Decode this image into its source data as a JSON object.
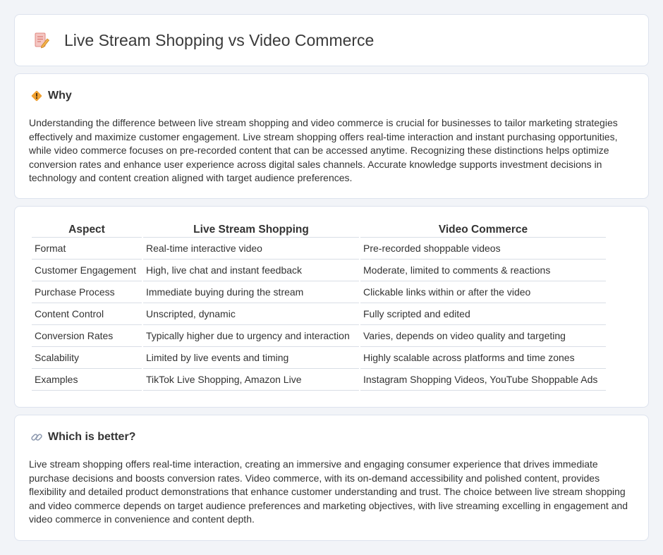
{
  "header": {
    "title": "Live Stream Shopping vs Video Commerce",
    "icon": "document-pen-icon"
  },
  "why": {
    "title": "Why",
    "icon": "diamond-signal-icon",
    "body": "Understanding the difference between live stream shopping and video commerce is crucial for businesses to tailor marketing strategies effectively and maximize customer engagement. Live stream shopping offers real-time interaction and instant purchasing opportunities, while video commerce focuses on pre-recorded content that can be accessed anytime. Recognizing these distinctions helps optimize conversion rates and enhance user experience across digital sales channels. Accurate knowledge supports investment decisions in technology and content creation aligned with target audience preferences."
  },
  "table": {
    "headers": [
      "Aspect",
      "Live Stream Shopping",
      "Video Commerce"
    ],
    "rows": [
      [
        "Format",
        "Real-time interactive video",
        "Pre-recorded shoppable videos"
      ],
      [
        "Customer Engagement",
        "High, live chat and instant feedback",
        "Moderate, limited to comments & reactions"
      ],
      [
        "Purchase Process",
        "Immediate buying during the stream",
        "Clickable links within or after the video"
      ],
      [
        "Content Control",
        "Unscripted, dynamic",
        "Fully scripted and edited"
      ],
      [
        "Conversion Rates",
        "Typically higher due to urgency and interaction",
        "Varies, depends on video quality and targeting"
      ],
      [
        "Scalability",
        "Limited by live events and timing",
        "Highly scalable across platforms and time zones"
      ],
      [
        "Examples",
        "TikTok Live Shopping, Amazon Live",
        "Instagram Shopping Videos, YouTube Shoppable Ads"
      ]
    ]
  },
  "better": {
    "title": "Which is better?",
    "icon": "link-icon",
    "body": "Live stream shopping offers real-time interaction, creating an immersive and engaging consumer experience that drives immediate purchase decisions and boosts conversion rates. Video commerce, with its on-demand accessibility and polished content, provides flexibility and detailed product demonstrations that enhance customer understanding and trust. The choice between live stream shopping and video commerce depends on target audience preferences and marketing objectives, with live streaming excelling in engagement and video commerce in convenience and content depth."
  },
  "colors": {
    "background": "#f2f4f8",
    "card": "#ffffff",
    "border": "#dde3ee",
    "accent": "#f0a030"
  }
}
